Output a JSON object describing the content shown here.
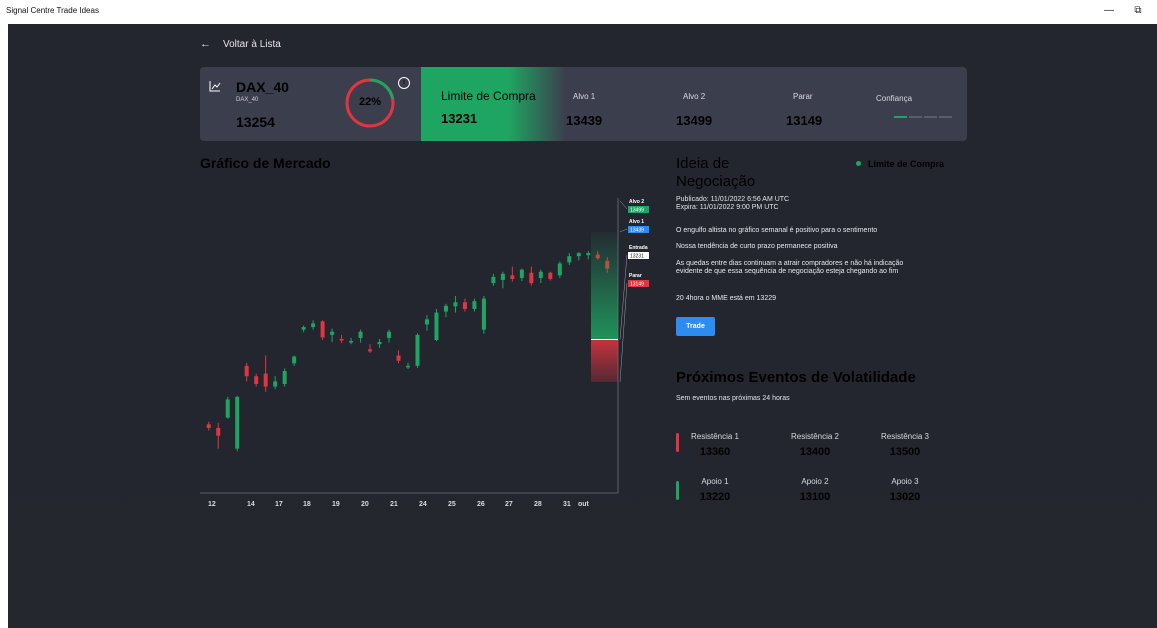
{
  "window": {
    "title": "Signal Centre Trade Ideas",
    "minimize": "—",
    "restore": "⧉"
  },
  "nav": {
    "back_arrow": "←",
    "back_label": "Voltar à Lista"
  },
  "instrument": {
    "icon": "line-chart-icon",
    "symbol": "DAX_40",
    "sub": "DAX_40",
    "price": "13254"
  },
  "gauge": {
    "percent_label": "22%",
    "value": 0.22,
    "info_glyph": "i",
    "colors": {
      "filled": "#1fa562",
      "rest": "#e2353f"
    }
  },
  "signal": {
    "label": "Limite de Compra",
    "value": "13231",
    "color": "#1fa562"
  },
  "targets": [
    {
      "label": "Alvo 1",
      "value": "13439"
    },
    {
      "label": "Alvo 2",
      "value": "13499"
    },
    {
      "label": "Parar",
      "value": "13149"
    }
  ],
  "confidence": {
    "label": "Confiança",
    "filled": 1,
    "total": 4,
    "colors": {
      "filled": "#1fa562",
      "rest": "#5a5d6c"
    }
  },
  "market": {
    "title": "Gráfico de Mercado"
  },
  "chart_data": {
    "type": "candlestick",
    "x_tick_labels": [
      "12",
      "14",
      "17",
      "18",
      "19",
      "20",
      "21",
      "24",
      "25",
      "26",
      "27",
      "28",
      "31",
      "out"
    ],
    "ylim": [
      12940,
      13520
    ],
    "candles": [
      {
        "o": 13067,
        "h": 13072,
        "l": 13055,
        "c": 13060,
        "dir": "down"
      },
      {
        "o": 13060,
        "h": 13070,
        "l": 13020,
        "c": 13045,
        "dir": "down"
      },
      {
        "o": 13080,
        "h": 13120,
        "l": 13078,
        "c": 13115,
        "dir": "up"
      },
      {
        "o": 13020,
        "h": 13122,
        "l": 13015,
        "c": 13120,
        "dir": "up"
      },
      {
        "o": 13180,
        "h": 13186,
        "l": 13150,
        "c": 13160,
        "dir": "down"
      },
      {
        "o": 13160,
        "h": 13165,
        "l": 13140,
        "c": 13145,
        "dir": "down"
      },
      {
        "o": 13165,
        "h": 13200,
        "l": 13130,
        "c": 13140,
        "dir": "down"
      },
      {
        "o": 13140,
        "h": 13160,
        "l": 13135,
        "c": 13150,
        "dir": "up"
      },
      {
        "o": 13145,
        "h": 13175,
        "l": 13140,
        "c": 13170,
        "dir": "up"
      },
      {
        "o": 13185,
        "h": 13200,
        "l": 13180,
        "c": 13198,
        "dir": "up"
      },
      {
        "o": 13250,
        "h": 13258,
        "l": 13245,
        "c": 13255,
        "dir": "up"
      },
      {
        "o": 13255,
        "h": 13268,
        "l": 13250,
        "c": 13262,
        "dir": "up"
      },
      {
        "o": 13266,
        "h": 13268,
        "l": 13230,
        "c": 13235,
        "dir": "down"
      },
      {
        "o": 13240,
        "h": 13252,
        "l": 13226,
        "c": 13246,
        "dir": "up"
      },
      {
        "o": 13232,
        "h": 13240,
        "l": 13224,
        "c": 13230,
        "dir": "down"
      },
      {
        "o": 13228,
        "h": 13234,
        "l": 13222,
        "c": 13228,
        "dir": "up"
      },
      {
        "o": 13234,
        "h": 13250,
        "l": 13225,
        "c": 13246,
        "dir": "up"
      },
      {
        "o": 13212,
        "h": 13222,
        "l": 13205,
        "c": 13208,
        "dir": "down"
      },
      {
        "o": 13222,
        "h": 13232,
        "l": 13215,
        "c": 13226,
        "dir": "up"
      },
      {
        "o": 13234,
        "h": 13250,
        "l": 13225,
        "c": 13246,
        "dir": "up"
      },
      {
        "o": 13200,
        "h": 13210,
        "l": 13185,
        "c": 13190,
        "dir": "down"
      },
      {
        "o": 13180,
        "h": 13186,
        "l": 13174,
        "c": 13180,
        "dir": "up"
      },
      {
        "o": 13180,
        "h": 13243,
        "l": 13176,
        "c": 13240,
        "dir": "up"
      },
      {
        "o": 13260,
        "h": 13278,
        "l": 13248,
        "c": 13270,
        "dir": "up"
      },
      {
        "o": 13230,
        "h": 13290,
        "l": 13228,
        "c": 13283,
        "dir": "up"
      },
      {
        "o": 13285,
        "h": 13300,
        "l": 13274,
        "c": 13296,
        "dir": "up"
      },
      {
        "o": 13295,
        "h": 13315,
        "l": 13283,
        "c": 13303,
        "dir": "up"
      },
      {
        "o": 13303,
        "h": 13310,
        "l": 13285,
        "c": 13290,
        "dir": "down"
      },
      {
        "o": 13290,
        "h": 13310,
        "l": 13285,
        "c": 13305,
        "dir": "up"
      },
      {
        "o": 13250,
        "h": 13315,
        "l": 13242,
        "c": 13310,
        "dir": "up"
      },
      {
        "o": 13340,
        "h": 13358,
        "l": 13335,
        "c": 13352,
        "dir": "up"
      },
      {
        "o": 13346,
        "h": 13362,
        "l": 13330,
        "c": 13358,
        "dir": "up"
      },
      {
        "o": 13355,
        "h": 13372,
        "l": 13343,
        "c": 13348,
        "dir": "down"
      },
      {
        "o": 13350,
        "h": 13368,
        "l": 13344,
        "c": 13366,
        "dir": "up"
      },
      {
        "o": 13360,
        "h": 13372,
        "l": 13335,
        "c": 13340,
        "dir": "down"
      },
      {
        "o": 13350,
        "h": 13366,
        "l": 13340,
        "c": 13362,
        "dir": "up"
      },
      {
        "o": 13360,
        "h": 13362,
        "l": 13345,
        "c": 13348,
        "dir": "down"
      },
      {
        "o": 13355,
        "h": 13382,
        "l": 13350,
        "c": 13378,
        "dir": "up"
      },
      {
        "o": 13380,
        "h": 13398,
        "l": 13375,
        "c": 13392,
        "dir": "up"
      },
      {
        "o": 13392,
        "h": 13400,
        "l": 13384,
        "c": 13398,
        "dir": "up"
      },
      {
        "o": 13394,
        "h": 13402,
        "l": 13386,
        "c": 13398,
        "dir": "up"
      },
      {
        "o": 13395,
        "h": 13402,
        "l": 13385,
        "c": 13388,
        "dir": "down"
      },
      {
        "o": 13383,
        "h": 13390,
        "l": 13360,
        "c": 13368,
        "dir": "down"
      }
    ],
    "levels": [
      {
        "name": "Alvo 2",
        "value": "13499",
        "color": "#1fa562"
      },
      {
        "name": "Alvo 1",
        "value": "13439",
        "color": "#2d8cf0"
      },
      {
        "name": "Entrada",
        "value": "13231",
        "color": "#ffffff"
      },
      {
        "name": "Parar",
        "value": "13149",
        "color": "#e2353f"
      }
    ],
    "colors": {
      "up": "#1fa562",
      "down": "#e2353f"
    }
  },
  "idea": {
    "title": "Ideia de Negociação",
    "signal_label": "Limite de Compra",
    "published": "Publicado: 11/01/2022 6:56 AM UTC",
    "expires": "Expira: 11/01/2022 9:00 PM UTC",
    "paragraphs": [
      "O engulfo altista no gráfico semanal é positivo para o sentimento",
      "Nossa tendência de curto prazo permanece positiva",
      "As quedas entre dias continuam a atrair compradores e não há indicação evidente de que essa sequência de negociação esteja chegando ao fim",
      "20 4hora o MME está em 13229"
    ],
    "trade_button": "Trade"
  },
  "volatility": {
    "title": "Próximos Eventos de Volatilidade",
    "subtitle": "Sem eventos nas próximas 24 horas"
  },
  "resistance": [
    {
      "label": "Resistência 1",
      "value": "13360"
    },
    {
      "label": "Resistência 2",
      "value": "13400"
    },
    {
      "label": "Resistência 3",
      "value": "13500"
    }
  ],
  "support": [
    {
      "label": "Apoio 1",
      "value": "13220"
    },
    {
      "label": "Apoio 2",
      "value": "13100"
    },
    {
      "label": "Apoio 3",
      "value": "13020"
    }
  ]
}
